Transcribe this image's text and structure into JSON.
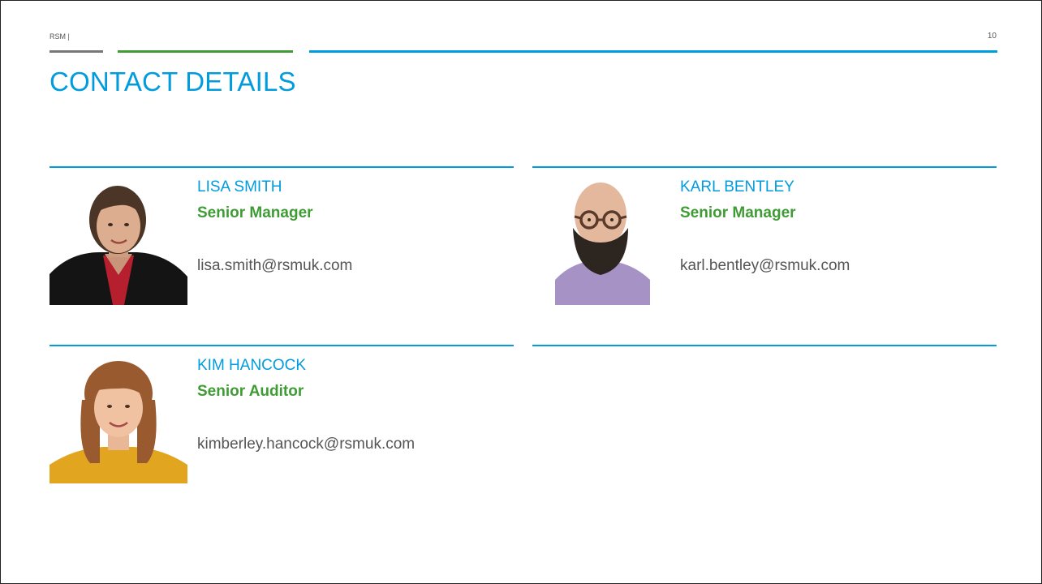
{
  "header": {
    "label": "RSM |",
    "page_number": "10"
  },
  "title": "CONTACT DETAILS",
  "colors": {
    "brand_blue": "#009cde",
    "brand_green": "#3f9c35",
    "brand_gray": "#777777"
  },
  "contacts": [
    {
      "name": "LISA SMITH",
      "role": "Senior Manager",
      "email": "lisa.smith@rsmuk.com"
    },
    {
      "name": "KARL BENTLEY",
      "role": "Senior Manager",
      "email": "karl.bentley@rsmuk.com"
    },
    {
      "name": "KIM HANCOCK",
      "role": "Senior Auditor",
      "email": "kimberley.hancock@rsmuk.com"
    }
  ]
}
